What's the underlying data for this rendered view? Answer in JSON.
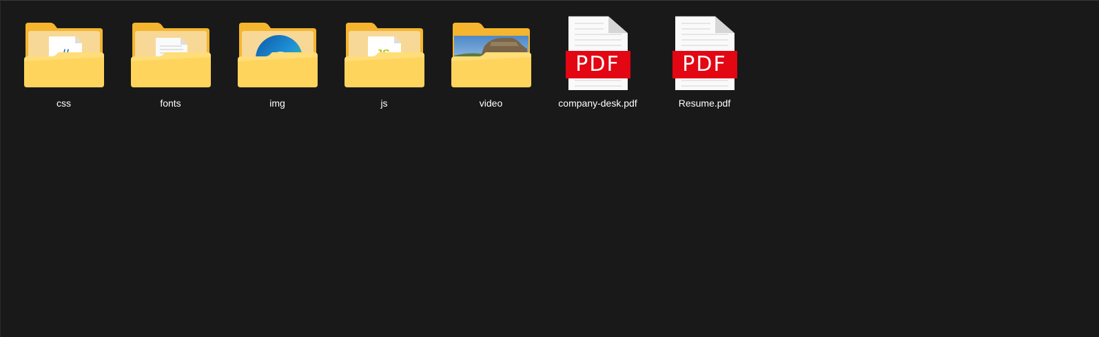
{
  "items": [
    {
      "name": "css",
      "kind": "folder",
      "preview": "css-file-icon"
    },
    {
      "name": "fonts",
      "kind": "folder",
      "preview": "document-icon"
    },
    {
      "name": "img",
      "kind": "folder",
      "preview": "edge-logo-icon"
    },
    {
      "name": "js",
      "kind": "folder",
      "preview": "js-file-icon"
    },
    {
      "name": "video",
      "kind": "folder",
      "preview": "landscape-thumbnail"
    },
    {
      "name": "company-desk.pdf",
      "kind": "pdf",
      "badge": "PDF"
    },
    {
      "name": "Resume.pdf",
      "kind": "pdf",
      "badge": "PDF"
    }
  ],
  "colors": {
    "background": "#191919",
    "folder_back": "#f7b731",
    "folder_front": "#ffd666",
    "pdf_badge": "#e30613",
    "label_text": "#ffffff"
  }
}
